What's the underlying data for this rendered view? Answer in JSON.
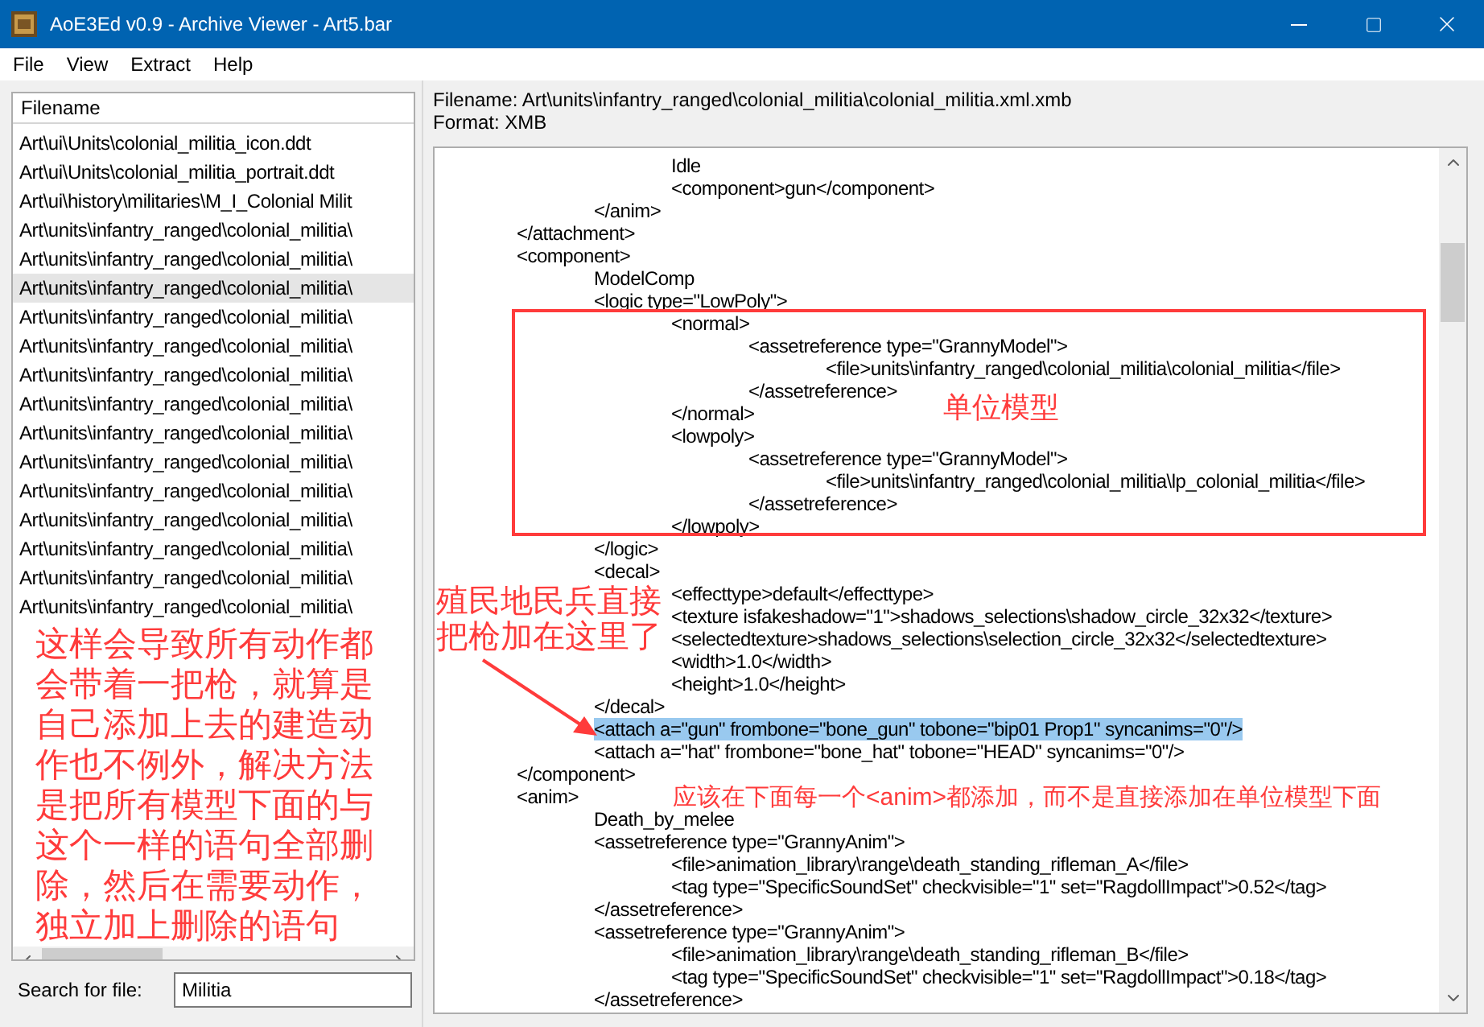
{
  "window": {
    "title": "AoE3Ed v0.9 - Archive Viewer - Art5.bar"
  },
  "menu": [
    "File",
    "View",
    "Extract",
    "Help"
  ],
  "file_list": {
    "column": "Filename",
    "rows": [
      {
        "text": "Art\\ui\\Units\\colonial_militia_icon.ddt",
        "selected": false
      },
      {
        "text": "Art\\ui\\Units\\colonial_militia_portrait.ddt",
        "selected": false
      },
      {
        "text": "Art\\ui\\history\\militaries\\M_I_Colonial Milit",
        "selected": false
      },
      {
        "text": "Art\\units\\infantry_ranged\\colonial_militia\\",
        "selected": false
      },
      {
        "text": "Art\\units\\infantry_ranged\\colonial_militia\\",
        "selected": false
      },
      {
        "text": "Art\\units\\infantry_ranged\\colonial_militia\\",
        "selected": true
      },
      {
        "text": "Art\\units\\infantry_ranged\\colonial_militia\\",
        "selected": false
      },
      {
        "text": "Art\\units\\infantry_ranged\\colonial_militia\\",
        "selected": false
      },
      {
        "text": "Art\\units\\infantry_ranged\\colonial_militia\\",
        "selected": false
      },
      {
        "text": "Art\\units\\infantry_ranged\\colonial_militia\\",
        "selected": false
      },
      {
        "text": "Art\\units\\infantry_ranged\\colonial_militia\\",
        "selected": false
      },
      {
        "text": "Art\\units\\infantry_ranged\\colonial_militia\\",
        "selected": false
      },
      {
        "text": "Art\\units\\infantry_ranged\\colonial_militia\\",
        "selected": false
      },
      {
        "text": "Art\\units\\infantry_ranged\\colonial_militia\\",
        "selected": false
      },
      {
        "text": "Art\\units\\infantry_ranged\\colonial_militia\\",
        "selected": false
      },
      {
        "text": "Art\\units\\infantry_ranged\\colonial_militia\\",
        "selected": false
      },
      {
        "text": "Art\\units\\infantry_ranged\\colonial_militia\\",
        "selected": false
      }
    ]
  },
  "list_note": "这样会导致所有动作都会带着一把枪，就算是自己添加上去的建造动作也不例外，解决方法是把所有模型下面的与这个一样的语句全部删除，然后在需要动作，独立加上删除的语句",
  "search": {
    "label": "Search for file:",
    "value": "Militia"
  },
  "viewer": {
    "filename": "Filename: Art\\units\\infantry_ranged\\colonial_militia\\colonial_militia.xml.xmb",
    "format": "Format: XMB",
    "lines": [
      {
        "children": [
          {
            "children": [
              {
                "text": "Idle",
                "selected": false
              },
              {
                "text": "<component>gun</component>",
                "selected": false
              }
            ]
          },
          {
            "text": "</anim>",
            "selected": false
          }
        ]
      },
      {
        "text": "</attachment>",
        "selected": false
      },
      {
        "text": "<component>",
        "selected": false,
        "children": [
          {
            "text": "ModelComp",
            "selected": false
          },
          {
            "text": "<logic type=\"LowPoly\">",
            "selected": false,
            "children": [
              {
                "text": "<normal>",
                "selected": false,
                "children": [
                  {
                    "text": "<assetreference type=\"GrannyModel\">",
                    "selected": false,
                    "children": [
                      {
                        "text": "<file>units\\infantry_ranged\\colonial_militia\\colonial_militia</file>",
                        "selected": false
                      }
                    ]
                  },
                  {
                    "text": "</assetreference>",
                    "selected": false
                  }
                ]
              },
              {
                "text": "</normal>",
                "selected": false
              },
              {
                "text": "<lowpoly>",
                "selected": false,
                "children": [
                  {
                    "text": "<assetreference type=\"GrannyModel\">",
                    "selected": false,
                    "children": [
                      {
                        "text": "<file>units\\infantry_ranged\\colonial_militia\\lp_colonial_militia</file>",
                        "selected": false
                      }
                    ]
                  },
                  {
                    "text": "</assetreference>",
                    "selected": false
                  }
                ]
              },
              {
                "text": "</lowpoly>",
                "selected": false
              }
            ]
          },
          {
            "text": "</logic>",
            "selected": false
          },
          {
            "text": "<decal>",
            "selected": false,
            "children": [
              {
                "text": "<effecttype>default</effecttype>",
                "selected": false
              },
              {
                "text": "<texture isfakeshadow=\"1\">shadows_selections\\shadow_circle_32x32</texture>",
                "selected": false
              },
              {
                "text": "<selectedtexture>shadows_selections\\selection_circle_32x32</selectedtexture>",
                "selected": false
              },
              {
                "text": "<width>1.0</width>",
                "selected": false
              },
              {
                "text": "<height>1.0</height>",
                "selected": false
              }
            ]
          },
          {
            "text": "</decal>",
            "selected": false
          },
          {
            "text": "<attach a=\"gun\" frombone=\"bone_gun\" tobone=\"bip01 Prop1\" syncanims=\"0\"/>",
            "selected": true
          },
          {
            "text": "<attach a=\"hat\" frombone=\"bone_hat\" tobone=\"HEAD\" syncanims=\"0\"/>",
            "selected": false
          }
        ]
      },
      {
        "text": "</component>",
        "selected": false
      },
      {
        "text": "<anim>",
        "selected": false,
        "children": [
          {
            "text": "Death_by_melee",
            "selected": false
          },
          {
            "text": "<assetreference type=\"GrannyAnim\">",
            "selected": false,
            "children": [
              {
                "text": "<file>animation_library\\range\\death_standing_rifleman_A</file>",
                "selected": false
              },
              {
                "text": "<tag type=\"SpecificSoundSet\" checkvisible=\"1\" set=\"RagdollImpact\">0.52</tag>",
                "selected": false
              }
            ]
          },
          {
            "text": "</assetreference>",
            "selected": false
          },
          {
            "text": "<assetreference type=\"GrannyAnim\">",
            "selected": false,
            "children": [
              {
                "text": "<file>animation_library\\range\\death_standing_rifleman_B</file>",
                "selected": false
              },
              {
                "text": "<tag type=\"SpecificSoundSet\" checkvisible=\"1\" set=\"RagdollImpact\">0.18</tag>",
                "selected": false
              }
            ]
          },
          {
            "text": "</assetreference>",
            "selected": false
          }
        ]
      }
    ]
  },
  "annotations": {
    "box_label": "单位模型",
    "arrow_note": "殖民地民兵直接把枪加在这里了",
    "bottom_note": "应该在下面每一个<anim>都添加，而不是直接添加在单位模型下面"
  }
}
